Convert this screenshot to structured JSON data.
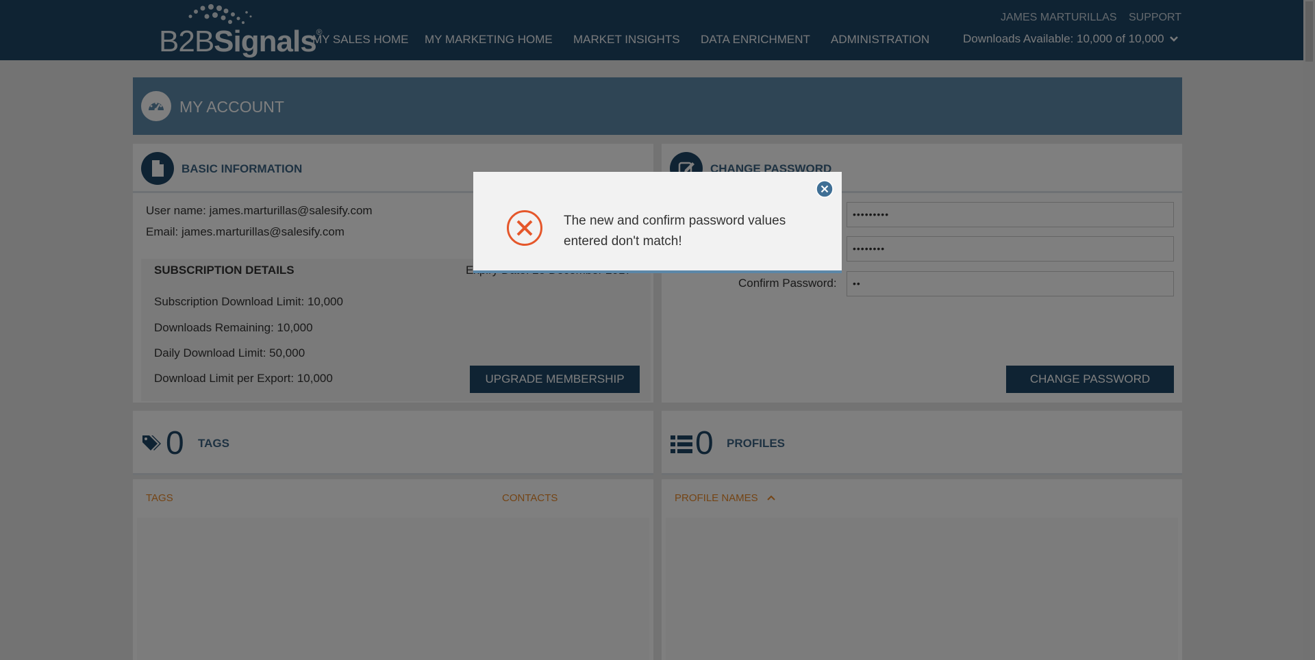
{
  "app": {
    "logo": {
      "text_light": "B2B",
      "text_bold": "Signals",
      "reg_mark": "®"
    },
    "nav": [
      "MY SALES HOME",
      "MY MARKETING HOME",
      "MARKET INSIGHTS",
      "DATA ENRICHMENT",
      "ADMINISTRATION"
    ],
    "user_name": "JAMES MARTURILLAS",
    "support_label": "SUPPORT",
    "downloads_label": "Downloads Available: 10,000 of 10,000",
    "downloads_icon": "chevron-down-icon"
  },
  "page": {
    "title": "MY ACCOUNT",
    "icon": "dashboard-icon"
  },
  "basic_info": {
    "title": "BASIC INFORMATION",
    "username_line": "User name: james.marturillas@salesify.com",
    "email_line": "Email: james.marturillas@salesify.com"
  },
  "subscription": {
    "title": "SUBSCRIPTION DETAILS",
    "expiry_partial": "Expiry Date: 25 December 2017",
    "lines": [
      "Subscription Download Limit: 10,000",
      "Downloads Remaining: 10,000",
      "Daily Download Limit: 50,000",
      "Download Limit per Export: 10,000"
    ],
    "upgrade_label": "UPGRADE MEMBERSHIP"
  },
  "change_password": {
    "title": "CHANGE PASSWORD",
    "current_value": "•••••••••",
    "new_value": "••••••••",
    "confirm_label": "Confirm Password:",
    "confirm_value": "••",
    "button_label": "CHANGE PASSWORD"
  },
  "tags": {
    "count": "0",
    "title": "TAGS",
    "col_tags": "TAGS",
    "col_contacts": "CONTACTS"
  },
  "profiles": {
    "count": "0",
    "title": "PROFILES",
    "col_names": "PROFILE NAMES"
  },
  "modal": {
    "message": "The new and confirm password values entered don't match!",
    "error_color": "#e5572b",
    "close_icon": "close-circle-icon"
  },
  "colors": {
    "navy": "#1f4766",
    "accent_orange": "#e8892a",
    "header_blue": "#5f8aab"
  }
}
